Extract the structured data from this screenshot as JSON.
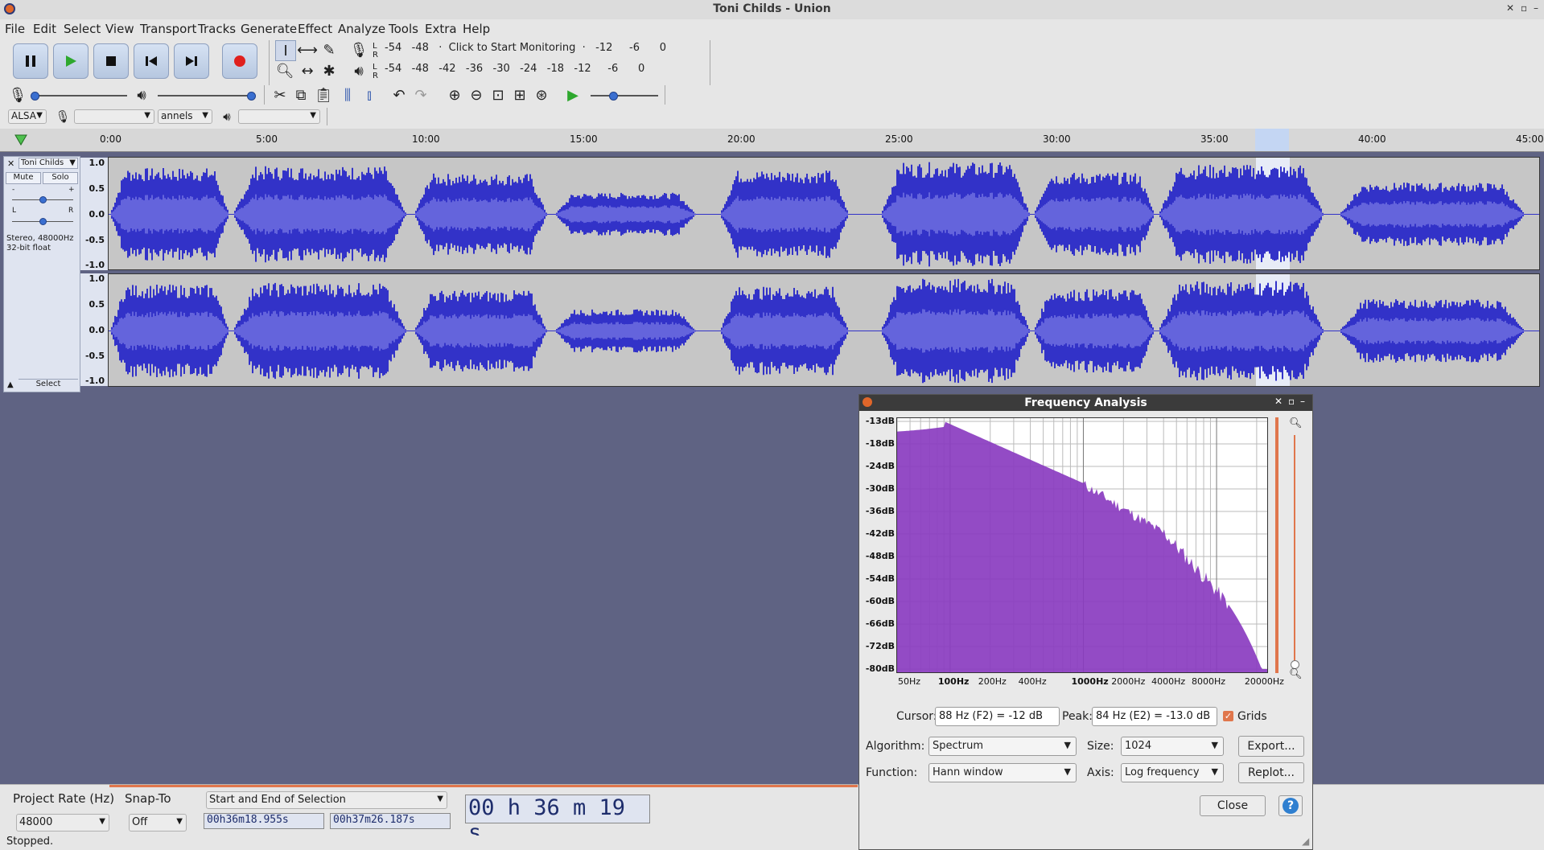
{
  "window": {
    "title": "Toni Childs - Union"
  },
  "menu": [
    "File",
    "Edit",
    "Select",
    "View",
    "Transport",
    "Tracks",
    "Generate",
    "Effect",
    "Analyze",
    "Tools",
    "Extra",
    "Help"
  ],
  "transport": {
    "buttons": [
      "pause-icon",
      "play-icon",
      "stop-icon",
      "skip-start-icon",
      "skip-end-icon",
      "record-icon"
    ]
  },
  "meters": {
    "record_scale": "-54   -48   ·  Click to Start Monitoring  ·   -12     -6      0",
    "play_scale": "-54   -48   -42   -36   -30   -24   -18   -12     -6      0",
    "lr_top": "L R",
    "lr_bottom": "L R"
  },
  "device": {
    "host": "ALSA",
    "channels": "annels"
  },
  "timeline": {
    "ticks": [
      "0:00",
      "5:00",
      "10:00",
      "15:00",
      "20:00",
      "25:00",
      "30:00",
      "35:00",
      "40:00",
      "45:00"
    ]
  },
  "track": {
    "name": "Toni Childs",
    "mute": "Mute",
    "solo": "Solo",
    "info": "Stereo, 48000Hz\n32-bit float",
    "select": "Select",
    "pan_l": "L",
    "pan_r": "R",
    "gain_minus": "-",
    "gain_plus": "+",
    "scale": [
      "1.0",
      "0.5",
      "0.0",
      "-0.5",
      "-1.0"
    ]
  },
  "bottom": {
    "project_rate_label": "Project Rate (Hz)",
    "project_rate": "48000",
    "snap_to_label": "Snap-To",
    "snap_to": "Off",
    "selection_mode": "Start and End of Selection",
    "sel_start": "00h36m18.955s",
    "sel_end": "00h37m26.187s",
    "audio_position": "00 h 36 m 19 s"
  },
  "status": "Stopped.",
  "dialog": {
    "title": "Frequency Analysis",
    "y_labels": [
      "-13dB",
      "-18dB",
      "-24dB",
      "-30dB",
      "-36dB",
      "-42dB",
      "-48dB",
      "-54dB",
      "-60dB",
      "-66dB",
      "-72dB",
      "-80dB"
    ],
    "x_labels": [
      "50Hz",
      "100Hz",
      "200Hz",
      "400Hz",
      "1000Hz",
      "2000Hz",
      "4000Hz",
      "8000Hz",
      "20000Hz"
    ],
    "cursor_label": "Cursor:",
    "cursor_value": "88 Hz (F2) = -12 dB",
    "peak_label": "Peak:",
    "peak_value": "84 Hz (E2) = -13.0 dB",
    "grids_label": "Grids",
    "algorithm_label": "Algorithm:",
    "algorithm": "Spectrum",
    "size_label": "Size:",
    "size": "1024",
    "function_label": "Function:",
    "function": "Hann window",
    "axis_label": "Axis:",
    "axis": "Log frequency",
    "export": "Export...",
    "replot": "Replot...",
    "close": "Close",
    "help": "?",
    "accent": "#8a3cc0"
  }
}
